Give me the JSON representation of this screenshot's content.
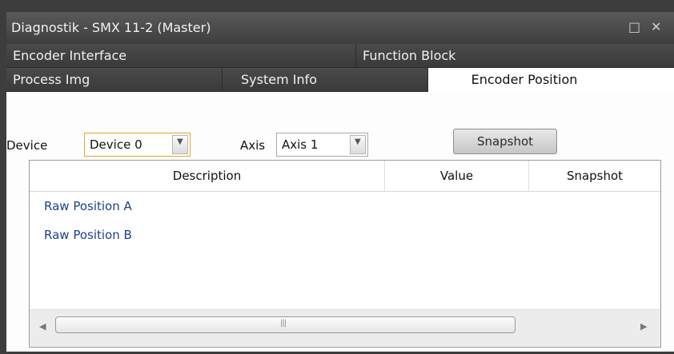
{
  "window": {
    "title": "Diagnostik - SMX 11-2 (Master)"
  },
  "tabs_row1": [
    "Encoder Interface",
    "Function Block"
  ],
  "tabs_row2": [
    "Process Img",
    "System Info",
    "Encoder Position"
  ],
  "controls": {
    "device_label": "Device",
    "device_value": "Device 0",
    "axis_label": "Axis",
    "axis_value": "Axis 1",
    "snapshot_button": "Snapshot"
  },
  "table": {
    "columns": [
      "Description",
      "Value",
      "Snapshot"
    ],
    "rows": [
      {
        "description": "Raw Position A",
        "value": "",
        "snapshot": ""
      },
      {
        "description": "Raw Position B",
        "value": "",
        "snapshot": ""
      }
    ]
  },
  "icons": [
    "maximize-icon",
    "close-icon",
    "dropdown-arrow-icon",
    "scroll-left-icon",
    "scroll-right-icon"
  ],
  "colors": {
    "titlebar": "#4a4a4a",
    "link_text": "#1f3f8a",
    "focus_border": "#e0a52e"
  }
}
